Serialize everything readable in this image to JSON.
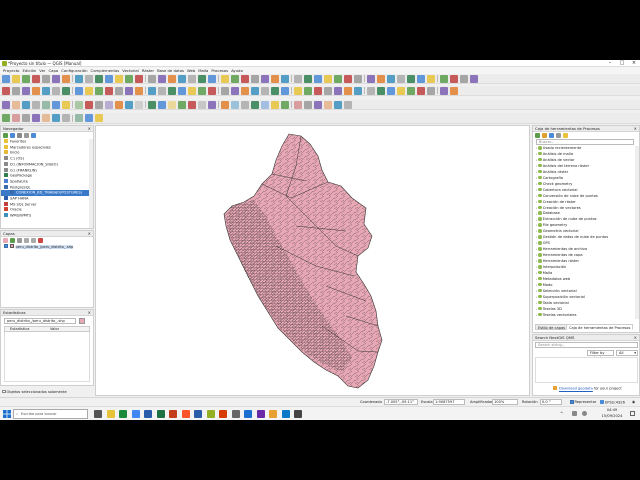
{
  "window": {
    "title": "*Proyecto sin título — QGIS [Manual]"
  },
  "menu": [
    "Proyecto",
    "Edición",
    "Ver",
    "Capa",
    "Configuración",
    "Complementos",
    "Vectorial",
    "Ráster",
    "Base de datos",
    "Web",
    "Malla",
    "Procesos",
    "Ayuda"
  ],
  "browser": {
    "title": "Navegador",
    "items": [
      {
        "label": "Favoritos",
        "color": "#e8c33a"
      },
      {
        "label": "Marcadores espaciales",
        "color": "#e8c33a"
      },
      {
        "label": "Inicio",
        "color": "#e8b83a"
      },
      {
        "label": "C:\\ (OS)",
        "color": "#8a8a8a"
      },
      {
        "label": "D:\\ (INFORMACION_SIGEO)",
        "color": "#8a8a8a"
      },
      {
        "label": "G:\\ (FRANKLIN)",
        "color": "#8a8a8a"
      },
      {
        "label": "GeoPackage",
        "color": "#2f7f4f"
      },
      {
        "label": "SpatiaLite",
        "color": "#4a7ed0"
      },
      {
        "label": "PostgreSQL",
        "color": "#3a6aa8"
      },
      {
        "label": "CONEXION_BD_TRABAJO(POSTGRES)",
        "color": "#3a6aa8",
        "selected": true
      },
      {
        "label": "SAP HANA",
        "color": "#2a5caa"
      },
      {
        "label": "MS SQL Server",
        "color": "#c04040"
      },
      {
        "label": "Oracle",
        "color": "#d04030"
      },
      {
        "label": "WMS/WMTS",
        "color": "#3a90c0"
      }
    ],
    "truncated_items": [
      "STAC"
    ]
  },
  "layers": {
    "title": "Capas",
    "items": [
      {
        "label": "peru_distrito_/peru_distrito_.shp",
        "checked": true,
        "color": "#e8a7b4"
      }
    ]
  },
  "stats": {
    "title": "Estadísticas",
    "layer_select": "peru_distrito_/peru_distrito_.shp",
    "columns": [
      "Estadística",
      "Valor"
    ]
  },
  "objects": {
    "label": "Objetos seleccionados solamente"
  },
  "toolbox": {
    "title": "Caja de herramientas de Procesos",
    "search_placeholder": "Buscar...",
    "items": [
      "Usado recientemente",
      "Análisis de malla",
      "Análisis de vector",
      "Análisis del terreno ráster",
      "Análisis ráster",
      "Cartografía",
      "Check geometry",
      "Cobertura vectorial",
      "Conversión de nube de puntos",
      "Creación de ráster",
      "Creación de vectores",
      "Database",
      "Extracción de nube de puntos",
      "File geometry",
      "Geometría vectorial",
      "Gestión de datos de nube de puntos",
      "GPS",
      "Herramientas de archivo",
      "Herramientas de capa",
      "Herramientas ráster",
      "Interpolación",
      "Malla",
      "Metadatos web",
      "Modo",
      "Selección vectorial",
      "Superposición vectorial",
      "Tabla vectorial",
      "Teselas 3D",
      "Teselas vectoriales"
    ],
    "tabs": [
      "Estilo de capas",
      "Caja de herramientas de Procesos"
    ]
  },
  "qms": {
    "title": "Search NextGIS QMS",
    "search_placeholder": "Search string...",
    "filter_label": "Filter by extent",
    "filter_value": "All",
    "download_text": "Download geodata",
    "download_suffix": "for your project"
  },
  "status": {
    "coord_label": "Coordenada",
    "coord": "-7.005°,-09.11°",
    "scale_label": "Escala",
    "scale": "1:9087597",
    "amp_label": "Amplificador",
    "amp": "100%",
    "rot_label": "Rotación",
    "rot": "0.0 °",
    "render_label": "Representar",
    "crs": "EPSG:4326"
  },
  "taskbar": {
    "search_placeholder": "Escriba para buscar",
    "time": "04:49",
    "date": "15/09/2024"
  },
  "colors": {
    "map_fill": "#e8a7b4",
    "map_stroke": "#333333",
    "accent": "#3a6fb0"
  }
}
